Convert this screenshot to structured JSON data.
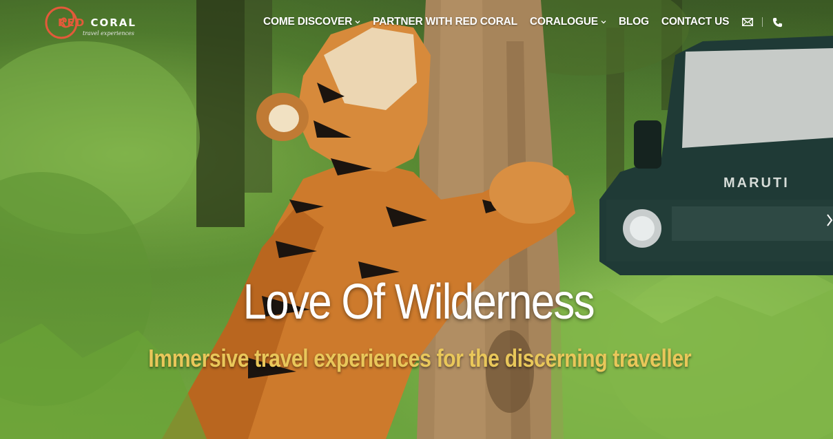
{
  "brand": {
    "word1": "RED",
    "word2": " CORAL",
    "tagline": "travel experiences",
    "accent_color": "#e35a3a"
  },
  "nav": {
    "items": [
      {
        "label": "COME DISCOVER",
        "has_dropdown": true
      },
      {
        "label": "PARTNER WITH RED CORAL",
        "has_dropdown": false
      },
      {
        "label": "CORALOGUE",
        "has_dropdown": true
      },
      {
        "label": "BLOG",
        "has_dropdown": false
      },
      {
        "label": "CONTACT US",
        "has_dropdown": false
      }
    ],
    "icons": [
      "envelope-icon",
      "phone-icon"
    ]
  },
  "hero": {
    "headline": "Love Of Wilderness",
    "subheadline": "Immersive travel experiences for the discerning traveller",
    "subheadline_color": "#e9c75a",
    "image_subject": [
      "tiger-hugging-tree",
      "safari-jeep",
      "forest"
    ]
  }
}
